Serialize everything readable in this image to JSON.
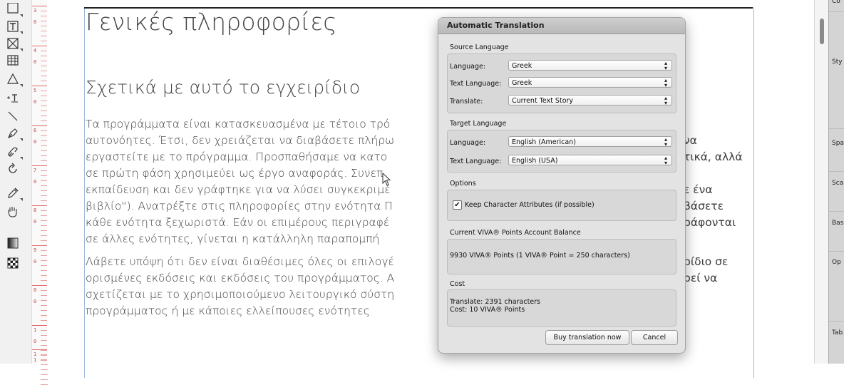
{
  "document": {
    "heading1": "Γενικές πληροφορίες",
    "heading2": "Σχετικά με αυτό το εγχειρίδιο",
    "paragraph1_left": [
      "Τα προγράμματα είναι κατασκευασμένα με τέτοιο τρό",
      "αυτονόητες. Έτσι, δεν χρειάζεται να διαβάσετε πλήρω",
      "εργαστείτε με το πρόγραμμα. Προσπαθήσαμε να κατο",
      "σε πρώτη φάση χρησιμεύει ως έργο αναφοράς. Συνεπ",
      "εκπαίδευση και δεν γράφτηκε για να λύσει συγκεκριμέ",
      "βιβλίο\"). Ανατρέξτε στις πληροφορίες στην ενότητα Π",
      "κάθε ενότητα ξεχωριστά. Εάν οι επιμέρους περιγραφέ",
      "σε άλλες ενότητες, γίνεται η κατάλληλη παραπομπή"
    ],
    "paragraph1_right": [
      "να",
      "τικά, αλλά",
      "",
      "ε ένα",
      "βάσετε",
      "ράφονται"
    ],
    "paragraph2_left": [
      "Λάβετε υπόψη ότι δεν είναι διαθέσιμες όλες οι επιλογέ",
      "ορισμένες εκδόσεις και εκδόσεις του προγράμματος. Α",
      "σχετίζεται με το χρησιμοποιούμενο λειτουργικό σύστη",
      "προγράμματος ή με κάποιες ελλείπουσες ενότητες"
    ],
    "paragraph2_right": [
      "ρίδιο σε",
      "ρεί να"
    ]
  },
  "ruler": {
    "labels": [
      "3",
      "4",
      "5",
      "6",
      "7",
      "8",
      "9",
      "0",
      "1",
      "1"
    ],
    "sublabels": [
      "0",
      "0",
      "0",
      "0",
      "0",
      "0",
      "0",
      "0",
      "0",
      "1"
    ]
  },
  "right_panel": {
    "labels": [
      "Co",
      "Sty",
      "Spa",
      "Sca",
      "Bas",
      "Op",
      "Tab"
    ]
  },
  "dialog": {
    "title": "Automatic Translation",
    "source": {
      "section_label": "Source Language",
      "language_label": "Language:",
      "language_value": "Greek",
      "text_language_label": "Text Language:",
      "text_language_value": "Greek",
      "translate_label": "Translate:",
      "translate_value": "Current Text Story"
    },
    "target": {
      "section_label": "Target Language",
      "language_label": "Language:",
      "language_value": "English (American)",
      "text_language_label": "Text Language:",
      "text_language_value": "English (USA)"
    },
    "options": {
      "section_label": "Options",
      "keep_attributes_label": "Keep Character Attributes (if possible)",
      "keep_attributes_checked": true,
      "check_mark": "✔"
    },
    "balance": {
      "section_label": "Current VIVA® Points Account Balance",
      "text": "9930 VIVA® Points (1 VIVA® Point = 250 characters)"
    },
    "cost": {
      "section_label": "Cost",
      "translate_line": "Translate: 2391 characters",
      "cost_line": "Cost: 10 VIVA® Points"
    },
    "buttons": {
      "buy": "Buy translation now",
      "cancel": "Cancel"
    }
  }
}
